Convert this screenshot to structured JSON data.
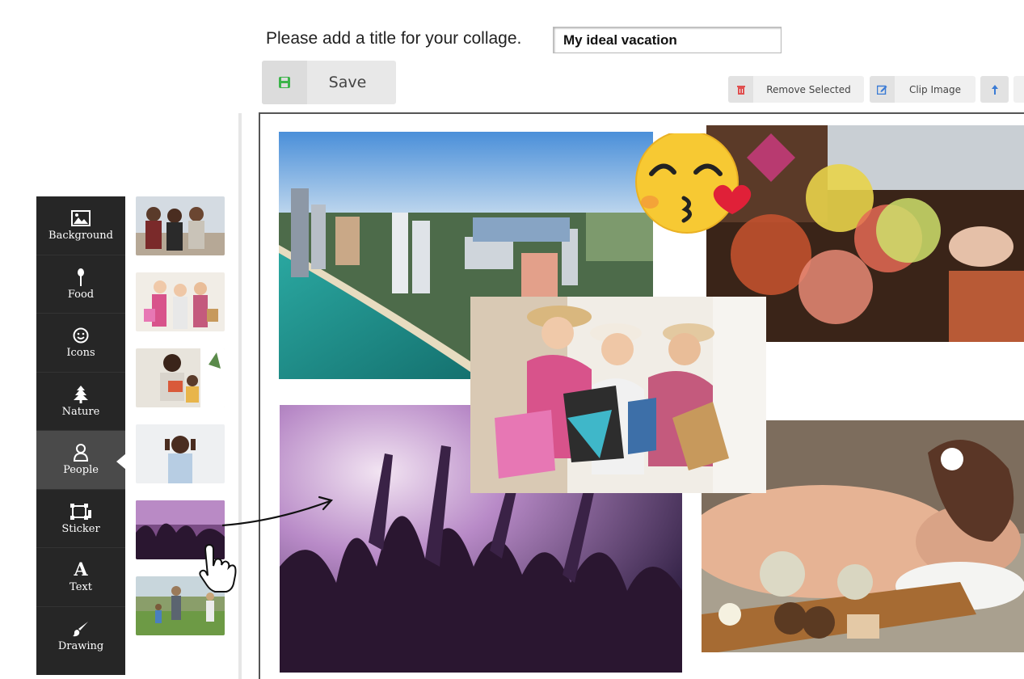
{
  "header": {
    "title_prompt": "Please add a title for your collage.",
    "title_value": "My ideal vacation"
  },
  "toolbar": {
    "save_label": "Save",
    "remove_label": "Remove Selected",
    "clip_label": "Clip Image"
  },
  "sidebar": {
    "items": [
      {
        "label": "Background",
        "icon": "image-icon"
      },
      {
        "label": "Food",
        "icon": "spoon-icon"
      },
      {
        "label": "Icons",
        "icon": "smiley-icon"
      },
      {
        "label": "Nature",
        "icon": "tree-icon"
      },
      {
        "label": "People",
        "icon": "person-icon",
        "active": true
      },
      {
        "label": "Sticker",
        "icon": "crop-icon"
      },
      {
        "label": "Text",
        "icon": "letter-a-icon"
      },
      {
        "label": "Drawing",
        "icon": "brush-icon"
      }
    ]
  },
  "colors": {
    "sidebar_bg": "#262626",
    "sidebar_active": "#4a4a4a",
    "save_icon": "#3cb44a",
    "remove_icon": "#e05050",
    "clip_icon": "#3a7bd5"
  }
}
